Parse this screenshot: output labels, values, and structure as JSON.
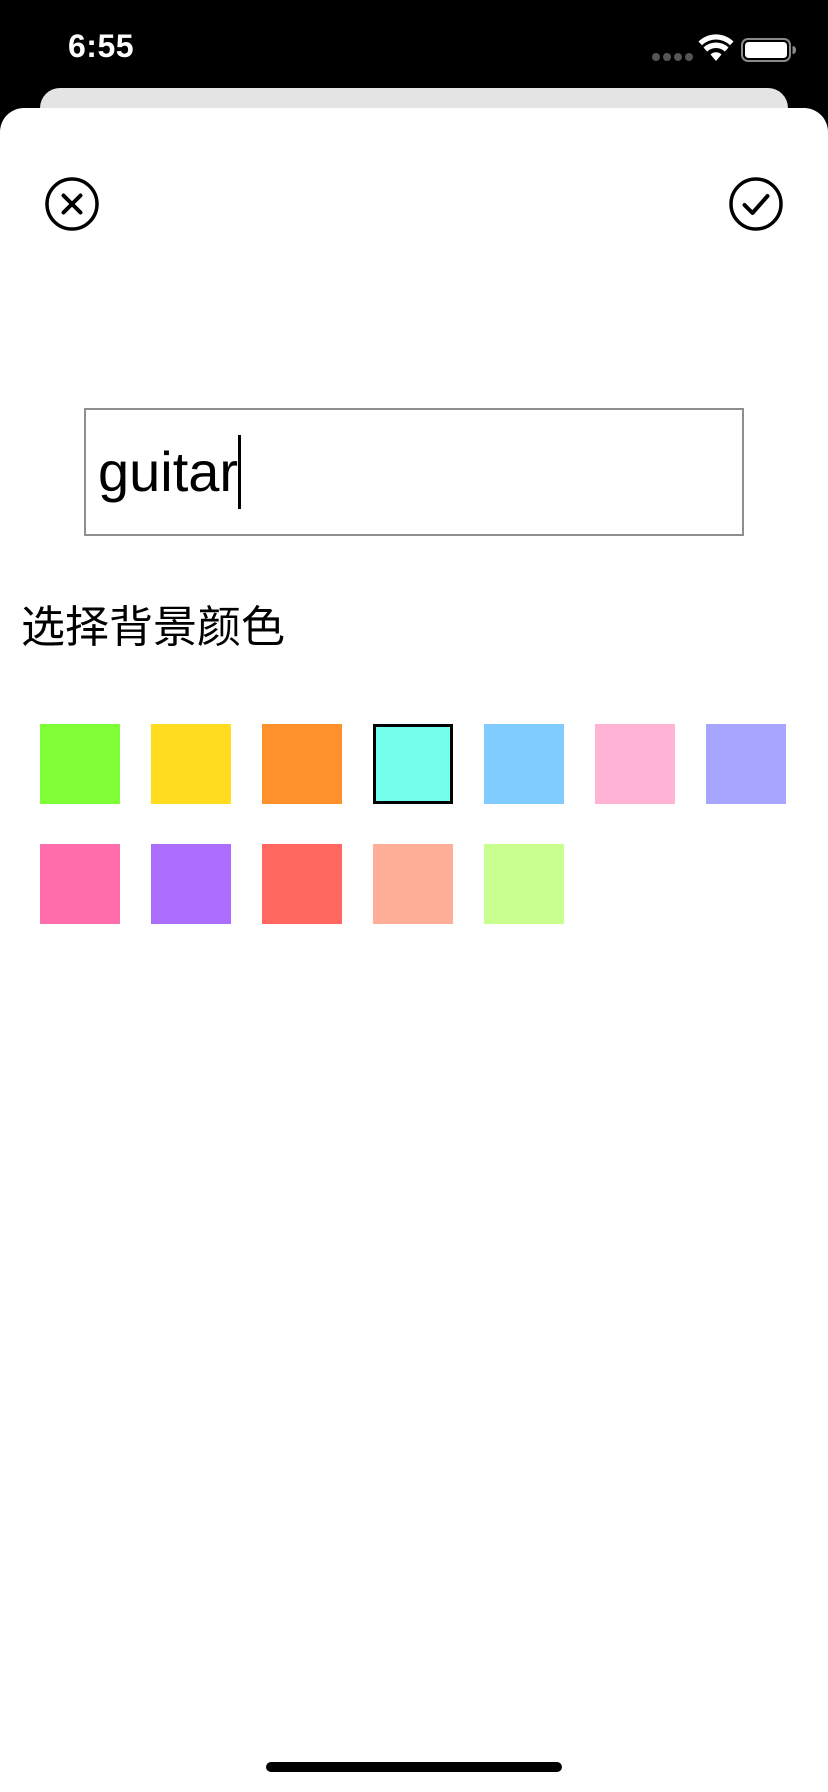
{
  "status_bar": {
    "time": "6:55"
  },
  "header": {
    "close_icon": "close-circle-icon",
    "confirm_icon": "checkmark-circle-icon"
  },
  "name_input": {
    "value": "guitar"
  },
  "color_section": {
    "label": "选择背景颜色",
    "swatches": [
      {
        "color": "#80ff38",
        "selected": false
      },
      {
        "color": "#ffdc1e",
        "selected": false
      },
      {
        "color": "#ff912d",
        "selected": false
      },
      {
        "color": "#74ffec",
        "selected": true
      },
      {
        "color": "#80cbff",
        "selected": false
      },
      {
        "color": "#ffb4d5",
        "selected": false
      },
      {
        "color": "#a7a5ff",
        "selected": false
      },
      {
        "color": "#ff6eab",
        "selected": false
      },
      {
        "color": "#ab6efd",
        "selected": false
      },
      {
        "color": "#ff675f",
        "selected": false
      },
      {
        "color": "#ffae97",
        "selected": false
      },
      {
        "color": "#c8ff8f",
        "selected": false
      }
    ]
  }
}
